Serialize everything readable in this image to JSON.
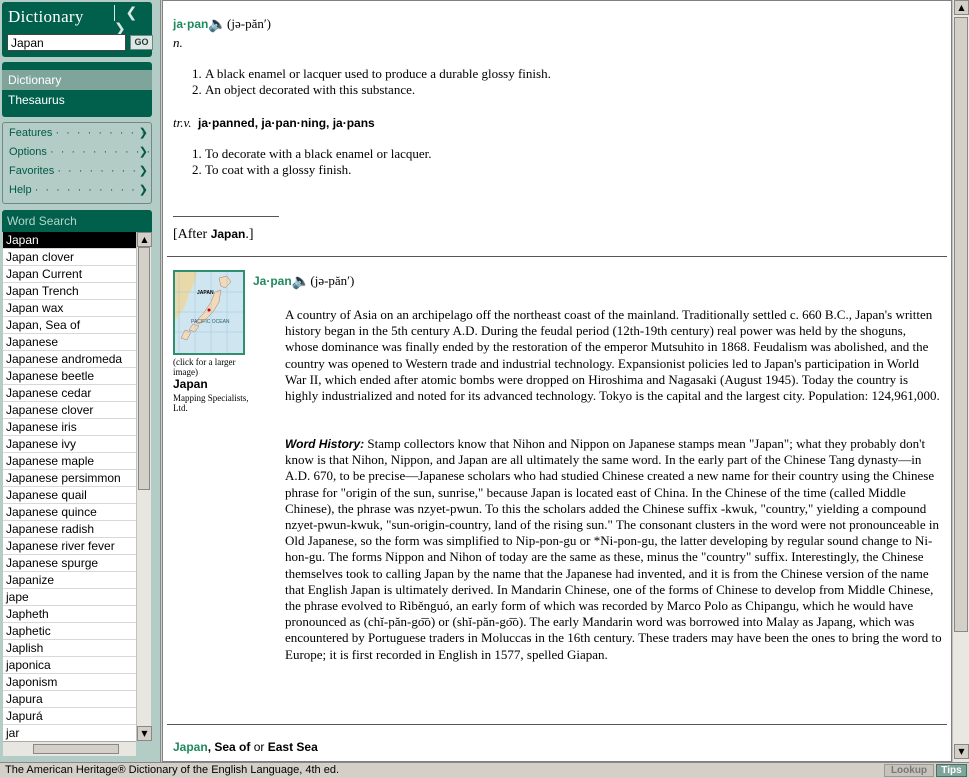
{
  "app": {
    "title": "Dictionary",
    "back_icon": "chevron-left-icon",
    "forward_icon": "chevron-right-icon"
  },
  "search": {
    "value": "Japan",
    "go_label": "GO"
  },
  "tabs": [
    {
      "label": "Dictionary",
      "active": true
    },
    {
      "label": "Thesaurus",
      "active": false
    }
  ],
  "menu": [
    {
      "label": "Features"
    },
    {
      "label": "Options"
    },
    {
      "label": "Favorites"
    },
    {
      "label": "Help"
    }
  ],
  "word_search": {
    "title": "Word Search",
    "selected": "Japan",
    "items": [
      "Japan",
      "Japan clover",
      "Japan Current",
      "Japan Trench",
      "Japan wax",
      "Japan, Sea of",
      "Japanese",
      "Japanese andromeda",
      "Japanese beetle",
      "Japanese cedar",
      "Japanese clover",
      "Japanese iris",
      "Japanese ivy",
      "Japanese maple",
      "Japanese persimmon",
      "Japanese quail",
      "Japanese quince",
      "Japanese radish",
      "Japanese river fever",
      "Japanese spurge",
      "Japanize",
      "jape",
      "Japheth",
      "Japhetic",
      "Japlish",
      "japonica",
      "Japonism",
      "Japura",
      "Japurá",
      "jar"
    ]
  },
  "entry1": {
    "headword": "ja·pan",
    "pron": "(jə-păn′)",
    "pos_noun": "n.",
    "noun_defs": [
      "A black enamel or lacquer used to produce a durable glossy finish.",
      "An object decorated with this substance."
    ],
    "pos_verb": "tr.v.",
    "verb_forms": "ja·panned, ja·pan·ning, ja·pans",
    "verb_defs": [
      "To decorate with a black enamel or lacquer.",
      "To coat with a glossy finish."
    ],
    "etym_open": "[After ",
    "etym_word": "Japan",
    "etym_close": ".]"
  },
  "entry2": {
    "headword": "Ja·pan",
    "pron": "(jə-păn′)",
    "map_ocean_label": "PACIFIC OCEAN",
    "map_country_label": "JAPAN",
    "caption_click": "(click for a larger image)",
    "caption_title": "Japan",
    "caption_credit": "Mapping Specialists, Ltd.",
    "body": "A country of Asia on an archipelago off the northeast coast of the mainland. Traditionally settled c. 660 B.C., Japan's written history began in the 5th century A.D. During the feudal period (12th-19th century) real power was held by the shoguns, whose dominance was finally ended by the restoration of the emperor Mutsuhito in 1868. Feudalism was abolished, and the country was opened to Western trade and industrial technology. Expansionist policies led to Japan's participation in World War II, which ended after atomic bombs were dropped on Hiroshima and Nagasaki (August 1945). Today the country is highly industrialized and noted for its advanced technology. Tokyo is the capital and the largest city. Population: 124,961,000.",
    "word_history_label": "Word History:",
    "word_history": "Stamp collectors know that Nihon and Nippon on Japanese stamps mean \"Japan\"; what they probably don't know is that Nihon, Nippon, and Japan are all ultimately the same word. In the early part of the Chinese Tang dynasty—in A.D. 670, to be precise—Japanese scholars who had studied Chinese created a new name for their country using the Chinese phrase for \"origin of the sun, sunrise,\" because Japan is located east of China. In the Chinese of the time (called Middle Chinese), the phrase was nzyet-pwun. To this the scholars added the Chinese suffix -kwuk, \"country,\" yielding a compound nzyet-pwun-kwuk, \"sun-origin-country, land of the rising sun.\" The consonant clusters in the word were not pronounceable in Old Japanese, so the form was simplified to Nip-pon-gu or *Ni-pon-gu, the latter developing by regular sound change to Ni-hon-gu. The forms Nippon and Nihon of today are the same as these, minus the \"country\" suffix. Interestingly, the Chinese themselves took to calling Japan by the name that the Japanese had invented, and it is from the Chinese version of the name that English Japan is ultimately derived. In Mandarin Chinese, one of the forms of Chinese to develop from Middle Chinese, the phrase evolved to Rìběnguó, an early form of which was recorded by Marco Polo as Chipangu, which he would have pronounced as (chĭ-păn-go͞o) or (shĭ-păn-go͞o). The early Mandarin word was borrowed into Malay as Japang, which was encountered by Portuguese traders in Moluccas in the 16th century. These traders may have been the ones to bring the word to Europe; it is first recorded in English in 1577, spelled Giapan."
  },
  "entry3": {
    "headword": "Japan",
    "rest": ", Sea of",
    "or": " or ",
    "alt": "East Sea"
  },
  "status": {
    "text": "The American Heritage® Dictionary of the English Language, 4th ed.",
    "lookup": "Lookup",
    "tips": "Tips"
  }
}
